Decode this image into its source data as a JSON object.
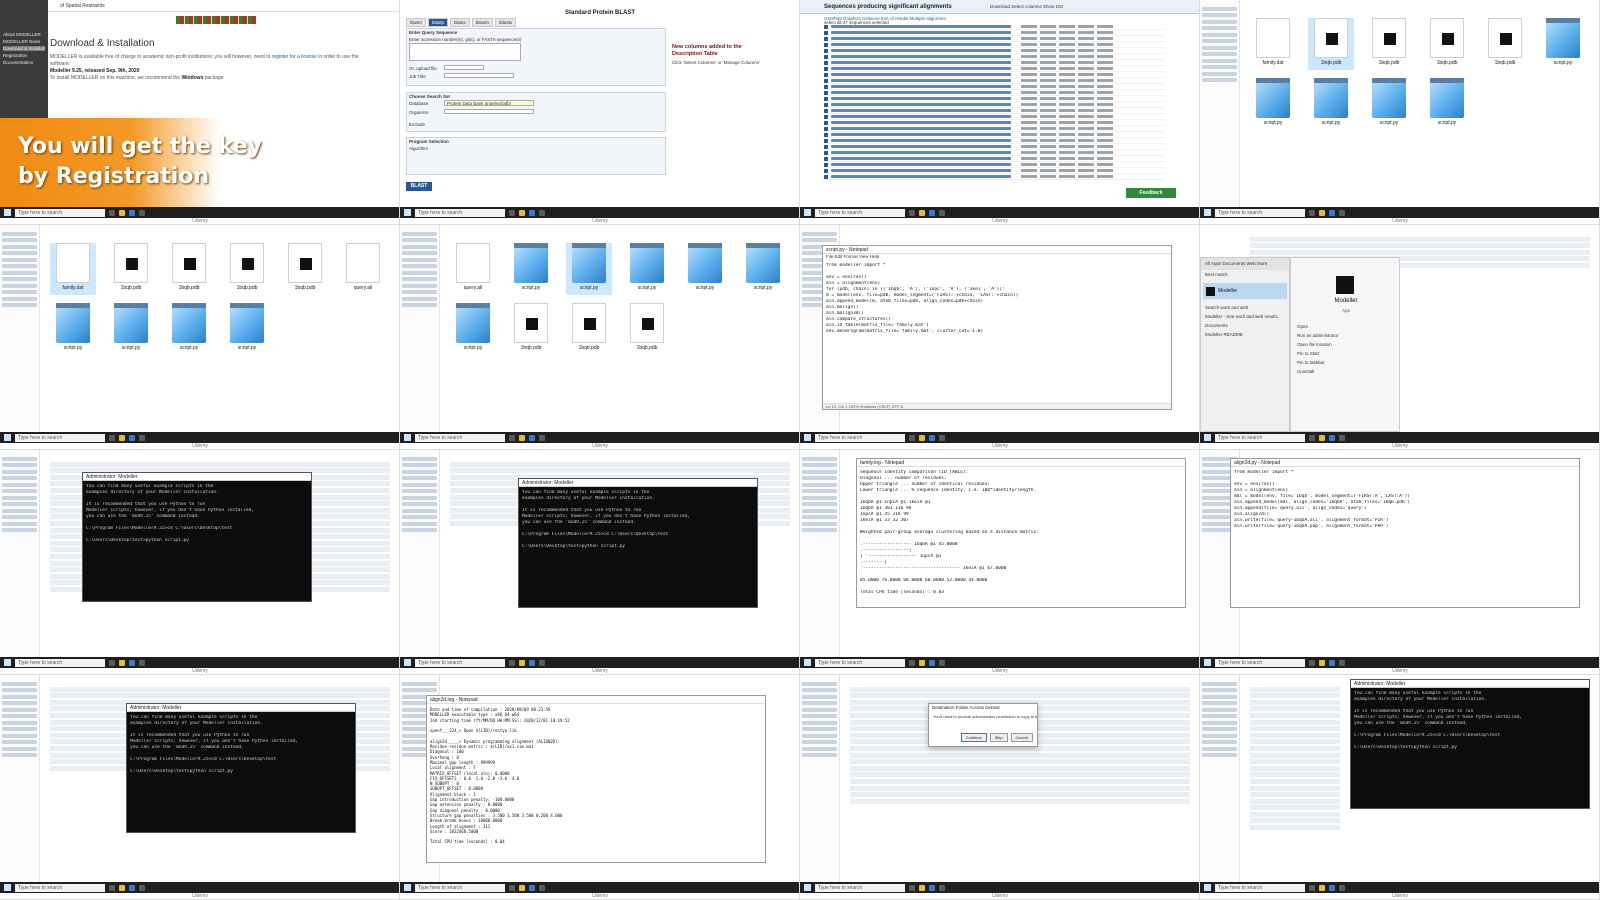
{
  "taskbar": {
    "search_placeholder": "Type here to search"
  },
  "watermark": "Udemy",
  "tile1": {
    "title": "Download & Installation",
    "nav": [
      "About MODELLER",
      "MODELLER News",
      "Download & Installation",
      "Registration",
      "Documentation"
    ],
    "text1_pre": "MODELLER is available free of charge to academic non-profit institutions; you will however, need to ",
    "text1_link": "register for a license",
    "text1_post": " in order to use the software.",
    "release": "Modeller 9.25, released Sep. 9th, 2020",
    "text2_pre": "To install MODELLER on this machine, we recommend the ",
    "text2_bold": "Windows",
    "text2_post": " package",
    "overlay_line1": "You will get the key",
    "overlay_line2": "by Registration",
    "banner": "of Spatial Restraints"
  },
  "tile2": {
    "heading": "Standard Protein BLAST",
    "tabs": [
      "blastn",
      "blastp",
      "blastx",
      "tblastn",
      "tblastx"
    ],
    "section1": "Enter Query Sequence",
    "query_label": "Enter accession number(s), gi(s), or FASTA sequence(s)",
    "upload_label": "Or, upload file",
    "job_title_label": "Job Title",
    "section2": "Choose Search Set",
    "database_label": "Database",
    "database_value": "Protein Data Bank proteins(pdb)",
    "organism_label": "Organism",
    "exclude_label": "Exclude",
    "section3": "Program Selection",
    "algorithm_label": "Algorithm",
    "note": "New columns added to the Description Table",
    "note_sub": "Click 'Select Columns' or 'Manage Columns'",
    "blast_button": "BLAST"
  },
  "tile3": {
    "title": "Sequences producing significant alignments",
    "controls": "Download  Select columns  Show 100",
    "tabs": "GenPept  Graphics  Distance tree of results  Multiple alignment",
    "select_all": "select all  27 sequences selected",
    "feedback": "Feedback"
  },
  "file_labels": {
    "dat": "family.dat",
    "pdb": "1bqb.pdb",
    "py": "script.py",
    "ali": "query.ali",
    "log": "build.log"
  },
  "tile6": {
    "title": "script.py - Notepad",
    "menu": "File  Edit  Format  View  Help",
    "lines": [
      "from modeller import *",
      "",
      "env = environ()",
      "aln = alignment(env)",
      "for (pdb, chain) in (('1bqb', 'A'), ('1npc', 'A'), ('1kei', 'A')):",
      "    m = model(env, file=pdb, model_segment=('FIRST:'+chain, 'LAST:'+chain))",
      "    aln.append_model(m, atom_files=pdb, align_codes=pdb+chain)",
      "aln.malign()",
      "aln.malign3d()",
      "aln.compare_structures()",
      "aln.id_table(matrix_file='family.mat')",
      "env.dendrogram(matrix_file='family.mat', cluster_cut=-1.0)"
    ],
    "status": "Ln 12, Col 1   100%   Windows (CRLF)   UTF-8"
  },
  "tile8": {
    "search_head": "All  Apps  Documents  Web  More",
    "best_match": "Best match",
    "app_name": "Modeller",
    "app_sub": "App",
    "items": [
      "Search work and web",
      "Modeller - See work and web results",
      "Documents",
      "Modeller README"
    ],
    "actions": [
      "Open",
      "Run as administrator",
      "Open file location",
      "Pin to Start",
      "Pin to taskbar",
      "Uninstall"
    ]
  },
  "console": {
    "title": "Administrator: Modeller",
    "lines": [
      "You can find many useful example scripts in the",
      "examples directory of your Modeller installation.",
      "",
      "It is recommended that you use Python to run",
      "Modeller scripts; however, if you don't have Python installed,",
      "you can use the 'mod9.25' command instead.",
      "",
      "C:\\Program Files\\Modeller9.25>cd C:\\Users\\Desktop\\test",
      "",
      "C:\\Users\\Desktop\\test>python script.py",
      ""
    ]
  },
  "tile11": {
    "title": "family.log - Notepad",
    "lines": [
      "Sequence identity comparison (ID_TABLE):",
      "  Diagonal        ... number of residues;",
      "  Upper triangle  ... number of identical residues;",
      "  Lower triangle  ... % sequence identity, i.e. 100*identity/length.",
      "",
      "           1bqbA @1  1npcA @1  1keiA @1",
      "1bqbA @1     301      136       96",
      "1npcA @1      45      316       99",
      "1keiA @1      33       32      307",
      "",
      "Weighted pair-group average clustering based on a distance matrix:",
      "",
      "                                   .------------------ 1bqbA @1  45.0000",
      "                 .-----------------|",
      "                 |                 '------------------ 1npcA @1",
      "        .--------|",
      "                 '------------------------------------ 1keiA @1  67.0000",
      "",
      "   85.0000  76.0000  68.0000  60.0000  52.0000  44.0000",
      "",
      "Total CPU time [seconds]  :        0.03"
    ]
  },
  "tile12": {
    "title": "align2d.py - Notepad",
    "lines": [
      "from modeller import *",
      "",
      "env = environ()",
      "aln = alignment(env)",
      "mdl = model(env, file='1bqb', model_segment=('FIRST:A','LAST:A'))",
      "aln.append_model(mdl, align_codes='1bqbA', atom_files='1bqb.pdb')",
      "aln.append(file='query.ali', align_codes='query')",
      "aln.align2d()",
      "aln.write(file='query-1bqbA.ali', alignment_format='PIR')",
      "aln.write(file='query-1bqbA.pap', alignment_format='PAP')"
    ]
  },
  "tile14": {
    "title": "align2d.log - Notepad",
    "lines": [
      "Date and time of compilation         : 2020/09/09 08:23:59",
      "MODELLER executable type             : x86_64-w64",
      "Job starting time (YY/MM/DD HH:MM:SS): 2020/12/01 10:19:52",
      "",
      "openf___224_> Open $(LIB)/restyp.lib",
      "",
      "align2d_____> Dynamic programming alignment (ALIGN2D):",
      "  Residue-residue metric  : $(LIB)/as1.sim.mat",
      "  Diagonal                :     100",
      "  Overhang                 :       0",
      "  Maximal gap length      :  999999",
      "  Local alignment         :       F",
      "  MATRIX_OFFSET (local aln):  0.0000",
      "  FIX_OFFSETS             :   0.0  -1.0  -2.0  -3.0  -4.0",
      "  N_SUBOPT                :       0",
      "  SUBOPT_OFFSET           :  0.0000",
      "  Alignment block         :       1",
      "  Gap introduction penalty: -100.0000",
      "  Gap extension penalty   :    0.0000",
      "  Gap diagonal penalty    :    0.0000",
      "  Structure gap penalties :   3.500  3.500  3.500  0.200  4.000",
      "  Break-break bonus       : 10000.0000",
      "  Length of alignment     :     311",
      "  Score                   : 1032468.5000",
      "",
      "Total CPU time [seconds]  :        0.04"
    ]
  },
  "tile15": {
    "dialog_title": "Destination Folder Access Denied",
    "dialog_msg": "You'll need to provide administrator permission to copy to this folder",
    "buttons": [
      "Continue",
      "Skip",
      "Cancel"
    ]
  }
}
